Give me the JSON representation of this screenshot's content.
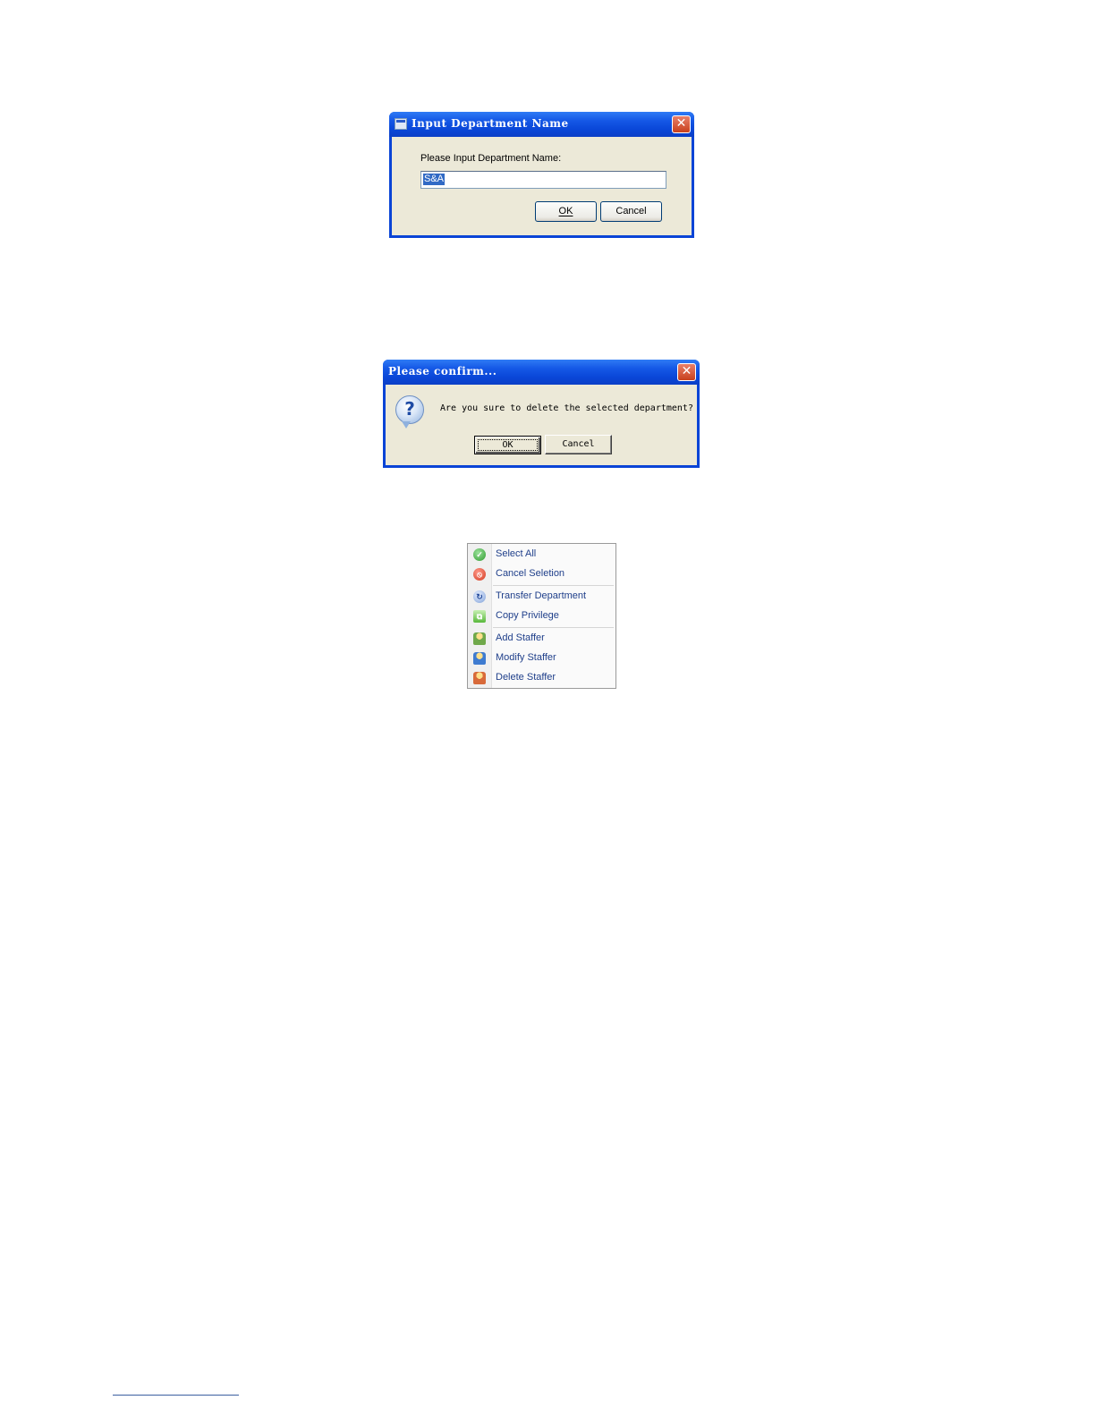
{
  "dialog_input": {
    "title": "Input Department Name",
    "prompt": "Please Input Department Name:",
    "value": "S&A",
    "ok_label": "OK",
    "cancel_label": "Cancel",
    "close_glyph": "✕"
  },
  "dialog_confirm": {
    "title": "Please confirm...",
    "message": "Are you sure to delete the selected department?",
    "icon": "question-icon",
    "ok_label": "OK",
    "cancel_label": "Cancel",
    "close_glyph": "✕"
  },
  "context_menu": {
    "items": [
      {
        "label": "Select All",
        "icon": "check-icon"
      },
      {
        "label": "Cancel Seletion",
        "icon": "cancel-icon"
      },
      {
        "label": "Transfer Department",
        "icon": "transfer-icon"
      },
      {
        "label": "Copy Privilege",
        "icon": "copy-icon"
      },
      {
        "label": "Add Staffer",
        "icon": "add-user-icon"
      },
      {
        "label": "Modify Staffer",
        "icon": "edit-user-icon"
      },
      {
        "label": "Delete Staffer",
        "icon": "delete-user-icon"
      }
    ]
  },
  "colors": {
    "titlebar": "#0a47d8",
    "dialog_face": "#ece9d8",
    "selection": "#316ac5",
    "menu_text": "#1f3f8a"
  }
}
